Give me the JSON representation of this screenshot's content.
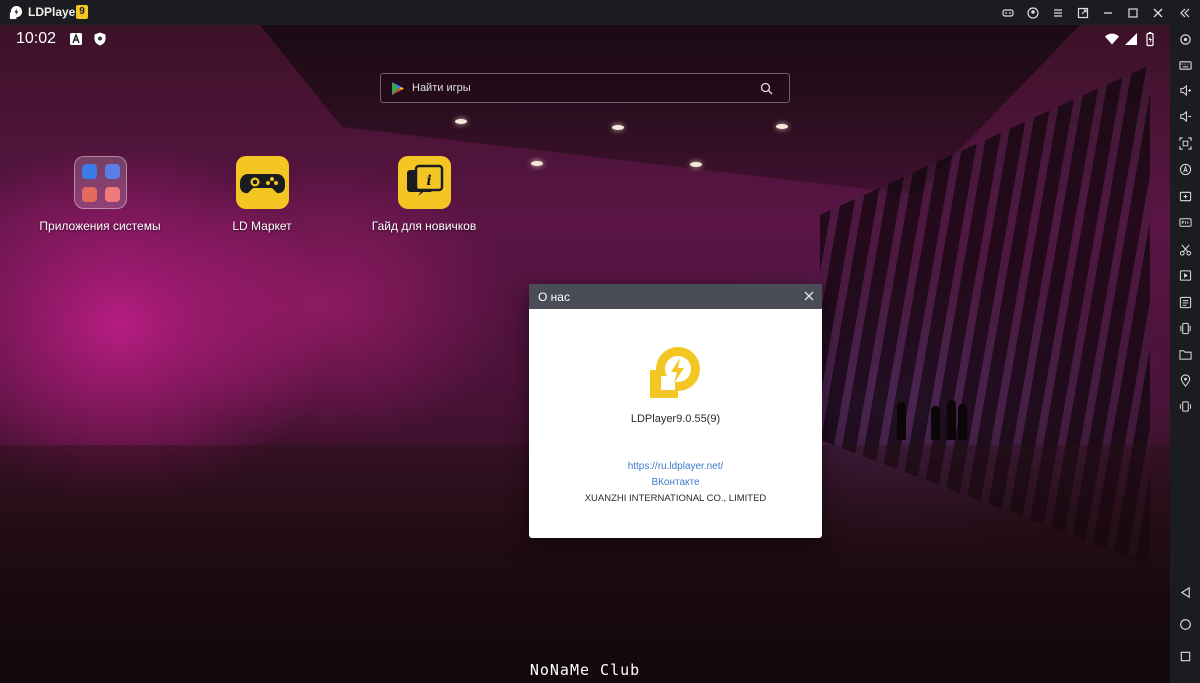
{
  "window": {
    "app_name": "LDPlayer",
    "version_badge": "9"
  },
  "titlebar_buttons": [
    "gamepad-icon",
    "account-icon",
    "menu-icon",
    "popout-icon",
    "minimize-icon",
    "maximize-icon",
    "close-icon",
    "collapse-icon"
  ],
  "sidebar_buttons": [
    "settings-icon",
    "keyboard-icon",
    "volume-up-icon",
    "volume-down-icon",
    "screenshot-icon",
    "macro-icon",
    "add-app-icon",
    "fps-icon",
    "scissors-icon",
    "record-icon",
    "sync-icon",
    "shake-icon",
    "folder-icon",
    "location-icon",
    "rotate-icon",
    "back-icon",
    "home-icon",
    "recents-icon"
  ],
  "statusbar": {
    "time": "10:02"
  },
  "search": {
    "placeholder": "Найти игры"
  },
  "apps": [
    {
      "label": "Приложения системы",
      "icon": "system-apps-folder"
    },
    {
      "label": "LD Маркет",
      "icon": "ld-market-icon"
    },
    {
      "label": "Гайд для новичков",
      "icon": "beginner-guide-icon"
    }
  ],
  "watermark": "NoNaMe Club",
  "dialog": {
    "title": "О нас",
    "version": "LDPlayer9.0.55(9)",
    "website": "https://ru.ldplayer.net/",
    "social": "ВКонтакте",
    "company": "XUANZHI INTERNATIONAL CO., LIMITED"
  },
  "colors": {
    "brand_yellow": "#f3c623",
    "titlebar_bg": "#1b1c20",
    "dialog_header": "#4a4d58",
    "link": "#3f7bc8"
  }
}
